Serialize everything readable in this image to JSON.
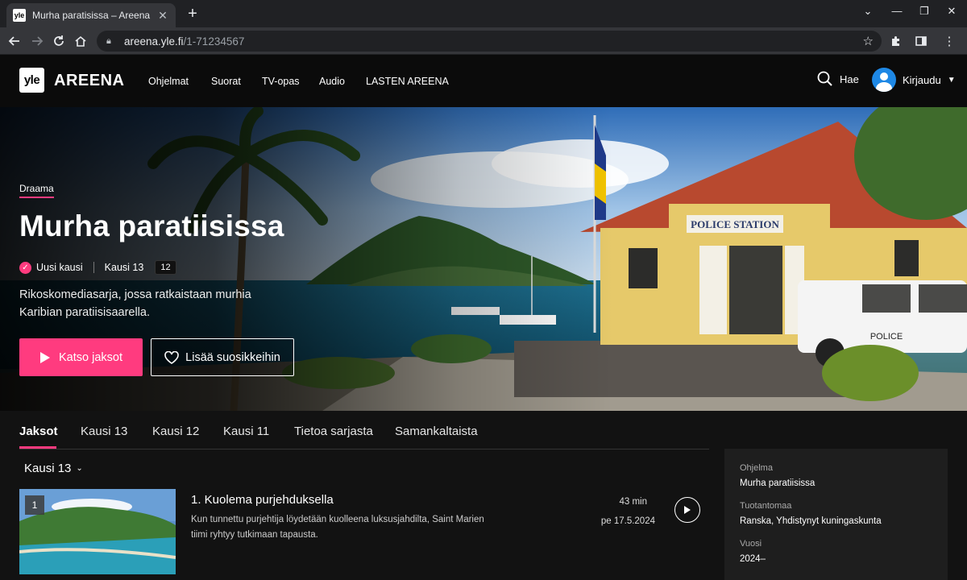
{
  "browser": {
    "tab_title": "Murha paratisissa – Areena",
    "favicon_text": "yle",
    "url_host": "areena.yle.fi",
    "url_path": "/1-71234567"
  },
  "site": {
    "logo_text": "yle",
    "brand": "AREENA",
    "nav": [
      "Ohjelmat",
      "Suorat",
      "TV-opas",
      "Audio",
      "LASTEN AREENA"
    ],
    "search_label": "Hae",
    "login_label": "Kirjaudu"
  },
  "hero": {
    "genre": "Draama",
    "title": "Murha paratiisissa",
    "badge_new": "Uusi kausi",
    "season": "Kausi 13",
    "age_rating": "12",
    "description": "Rikoskomediasarja, jossa ratkaistaan murhia Karibian paratiisisaarella.",
    "watch_button": "Katso jaksot",
    "favorite_button": "Lisää suosikkeihin",
    "sign_text": "POLICE STATION",
    "car_text": "POLICE"
  },
  "tabs": [
    "Jaksot",
    "Kausi 13",
    "Kausi 12",
    "Kausi 11",
    "Tietoa sarjasta",
    "Samankaltaista"
  ],
  "season_selector": "Kausi 13",
  "episodes": [
    {
      "number": "1",
      "title": "1. Kuolema purjehduksella",
      "description": "Kun tunnettu purjehtija löydetään kuolleena luksusjahdilta, Saint Marien tiimi ryhtyy tutkimaan tapausta.",
      "duration": "43 min",
      "date": "pe 17.5.2024"
    }
  ],
  "info": {
    "program_label": "Ohjelma",
    "program_value": "Murha paratiisissa",
    "country_label": "Tuotantomaa",
    "country_value": "Ranska, Yhdistynyt kuningaskunta",
    "year_label": "Vuosi",
    "year_value": "2024–"
  },
  "colors": {
    "accent": "#ff3b7f",
    "background": "#121212",
    "header": "#0b0b0b"
  }
}
